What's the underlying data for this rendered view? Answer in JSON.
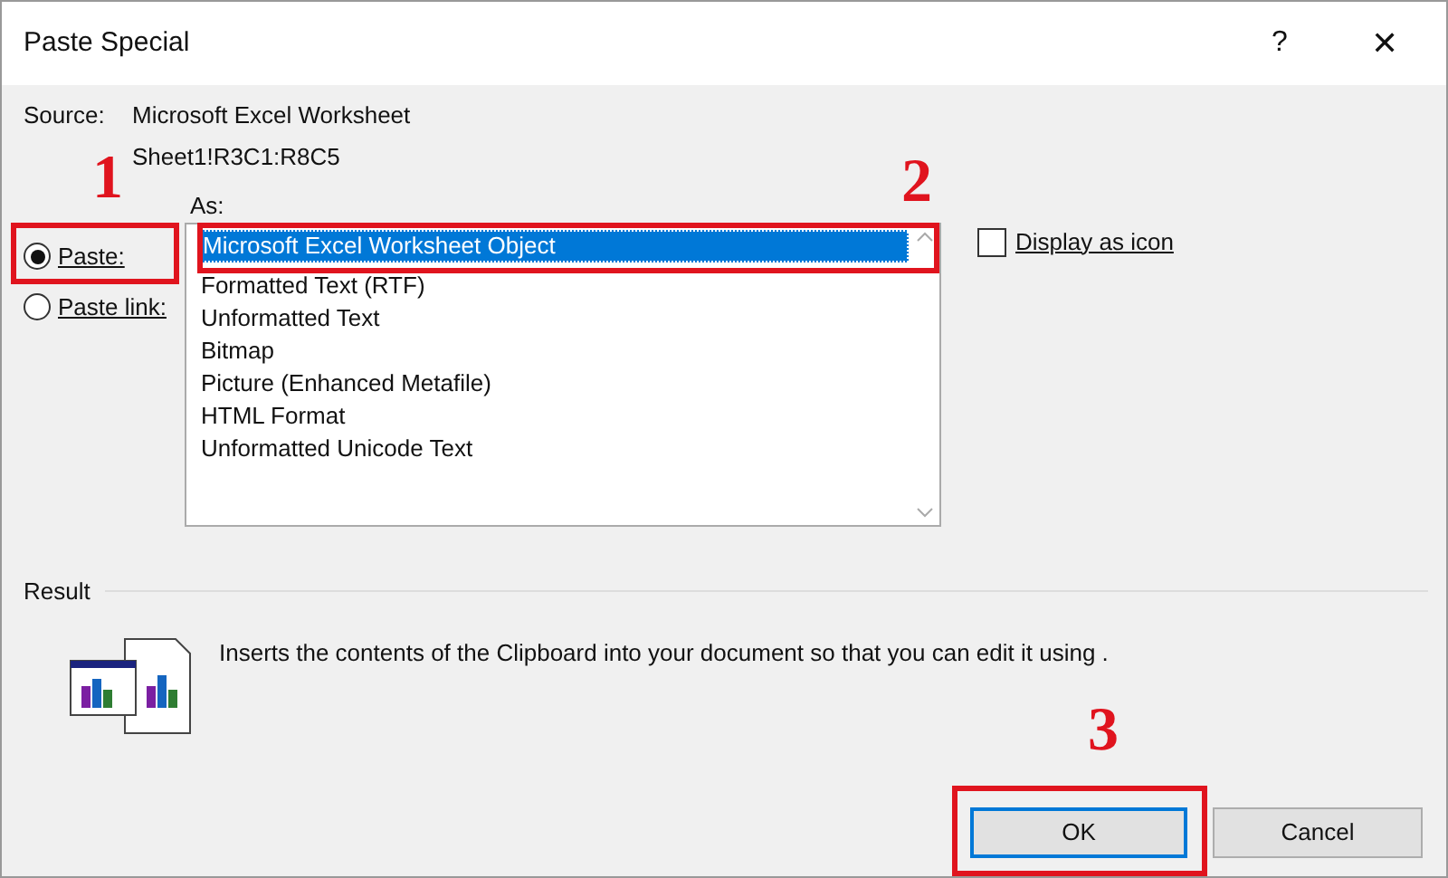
{
  "window": {
    "title": "Paste Special",
    "help": "?",
    "close": "✕"
  },
  "source": {
    "label": "Source:",
    "value": "Microsoft Excel Worksheet",
    "range": "Sheet1!R3C1:R8C5"
  },
  "paste_options": [
    {
      "label": "Paste:",
      "selected": true
    },
    {
      "label": "Paste link:",
      "selected": false
    }
  ],
  "as_label": "As:",
  "as_list": [
    {
      "label": "Microsoft Excel Worksheet Object",
      "selected": true
    },
    {
      "label": "Formatted Text (RTF)",
      "selected": false
    },
    {
      "label": "Unformatted Text",
      "selected": false
    },
    {
      "label": "Bitmap",
      "selected": false
    },
    {
      "label": "Picture (Enhanced Metafile)",
      "selected": false
    },
    {
      "label": "HTML Format",
      "selected": false
    },
    {
      "label": "Unformatted Unicode Text",
      "selected": false
    }
  ],
  "display_as_icon": {
    "label": "Display as icon",
    "checked": false
  },
  "result": {
    "label": "Result",
    "text": "Inserts the contents of the Clipboard into your document so that you can edit it using ."
  },
  "buttons": [
    {
      "label": "OK",
      "kind": "default"
    },
    {
      "label": "Cancel",
      "kind": "normal"
    }
  ],
  "annotations": [
    {
      "number": "1"
    },
    {
      "number": "2"
    },
    {
      "number": "3"
    }
  ]
}
